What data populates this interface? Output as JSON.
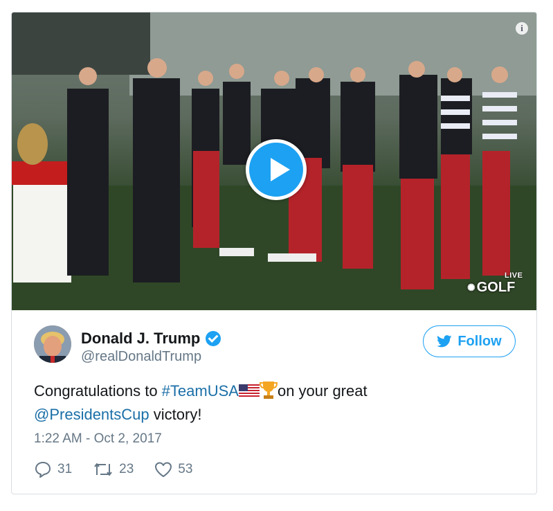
{
  "media": {
    "live_label": "LIVE",
    "network_label": "GOLF",
    "info_glyph": "i",
    "icons": {
      "info": "info-icon",
      "play": "play-icon",
      "network": "nbc-peacock-icon"
    }
  },
  "author": {
    "name": "Donald J. Trump",
    "handle": "@realDonaldTrump",
    "avatar": "avatar",
    "verified_icon": "verified-badge-icon"
  },
  "follow": {
    "label": "Follow",
    "icon": "twitter-bird-icon"
  },
  "tweet": {
    "text_before": "Congratulations to ",
    "hashtag": "#TeamUSA",
    "emojis": [
      "us-flag",
      "trophy"
    ],
    "text_middle": "on your great ",
    "mention": "@PresidentsCup",
    "text_after": " victory!"
  },
  "timestamp": "1:22 AM - Oct 2, 2017",
  "actions": {
    "replies": "31",
    "retweets": "23",
    "likes": "53"
  },
  "colors": {
    "accent": "#1da1f2",
    "link": "#1b6fa8",
    "muted": "#657786",
    "text": "#14171a"
  }
}
